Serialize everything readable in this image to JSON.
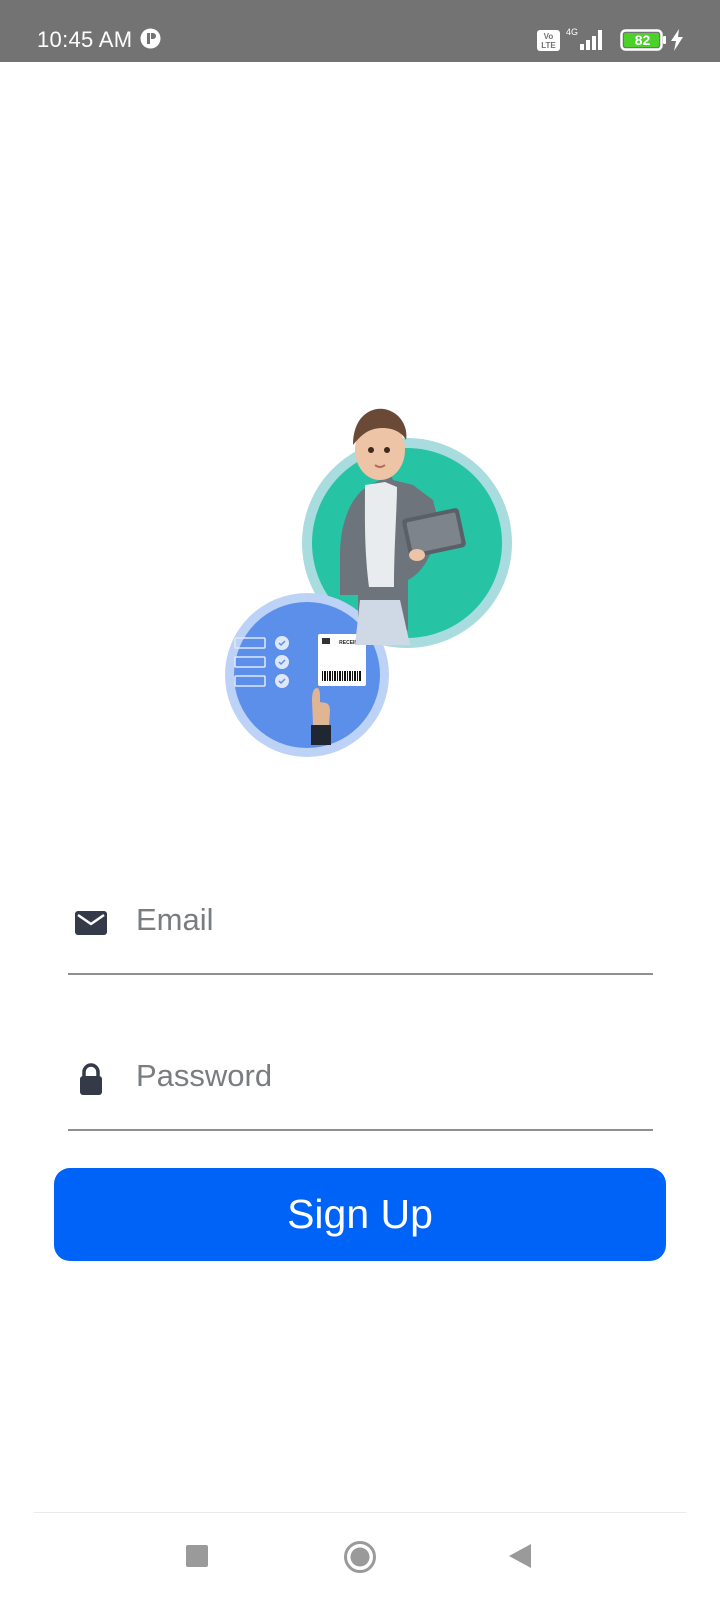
{
  "status_bar": {
    "time": "10:45 AM",
    "network_badge": "Vo LTE",
    "network_type": "4G",
    "battery_level": "82",
    "icons": [
      "app-notification-icon",
      "volte-icon",
      "signal-icon",
      "battery-icon",
      "charging-icon"
    ]
  },
  "hero": {
    "illustration": "woman-with-tablet-and-receipt-illustration",
    "receipt_text": "RECEIPT",
    "colors": {
      "teal_circle": "#26c3a5",
      "teal_ring": "#a9dcdf",
      "blue_circle": "#5b8fea",
      "blue_ring": "#bcd2f7"
    }
  },
  "form": {
    "email": {
      "placeholder": "Email",
      "value": "",
      "icon": "mail-icon"
    },
    "password": {
      "placeholder": "Password",
      "value": "",
      "icon": "lock-icon"
    }
  },
  "signup_button": {
    "label": "Sign Up",
    "color": "#0063f7"
  },
  "nav_bar": {
    "items": [
      "recents-button",
      "home-button",
      "back-button"
    ]
  }
}
